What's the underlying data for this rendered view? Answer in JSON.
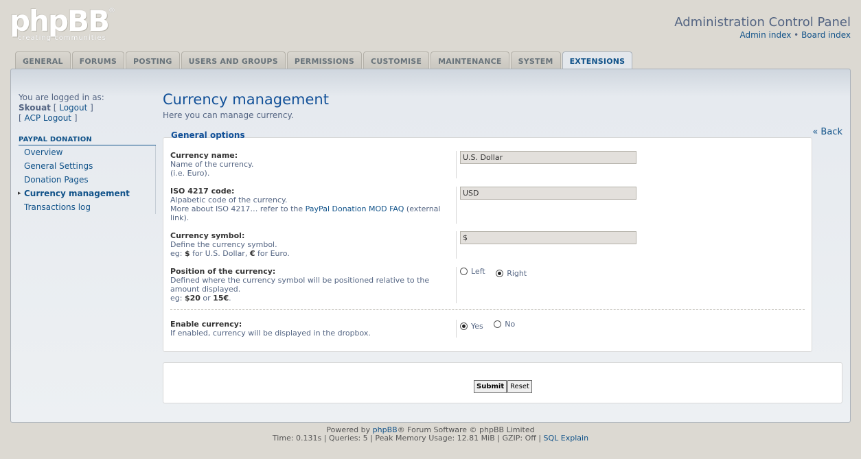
{
  "header": {
    "logo_text": "phpBB",
    "logo_sub": "creating communities",
    "logo_reg": "®",
    "title": "Administration Control Panel",
    "link_admin": "Admin index",
    "link_sep": " • ",
    "link_board": "Board index"
  },
  "tabs": [
    {
      "label": "GENERAL"
    },
    {
      "label": "FORUMS"
    },
    {
      "label": "POSTING"
    },
    {
      "label": "USERS AND GROUPS"
    },
    {
      "label": "PERMISSIONS"
    },
    {
      "label": "CUSTOMISE"
    },
    {
      "label": "MAINTENANCE"
    },
    {
      "label": "SYSTEM"
    },
    {
      "label": "EXTENSIONS"
    }
  ],
  "sidebar": {
    "logged_in_as": "You are logged in as:",
    "username": "Skouat",
    "logout_open": " [ ",
    "logout": "Logout",
    "logout_close": " ]",
    "acp_open": "[ ",
    "acp_logout": "ACP Logout",
    "acp_close": " ]",
    "menu_head": "PAYPAL DONATION",
    "items": [
      {
        "label": "Overview"
      },
      {
        "label": "General Settings"
      },
      {
        "label": "Donation Pages"
      },
      {
        "label": "Currency management"
      },
      {
        "label": "Transactions log"
      }
    ]
  },
  "main": {
    "title": "Currency management",
    "description": "Here you can manage currency.",
    "back": "« Back",
    "legend": "General options",
    "fields": {
      "name": {
        "label": "Currency name:",
        "desc1": "Name of the currency.",
        "desc2": "(i.e. Euro).",
        "value": "U.S. Dollar"
      },
      "iso": {
        "label": "ISO 4217 code:",
        "desc1": "Alpabetic code of the currency.",
        "desc2_pre": "More about ISO 4217… refer to the ",
        "desc2_link": "PayPal Donation MOD FAQ",
        "desc2_post": " (external link).",
        "value": "USD"
      },
      "symbol": {
        "label": "Currency symbol:",
        "desc1": "Define the currency symbol.",
        "desc2_pre": "eg: ",
        "desc2_b1": "$",
        "desc2_mid": " for U.S. Dollar, ",
        "desc2_b2": "€",
        "desc2_post": " for Euro.",
        "value": "$"
      },
      "position": {
        "label": "Position of the currency:",
        "desc1": "Defined where the currency symbol will be positioned relative to the amount displayed.",
        "desc2_pre": "eg: ",
        "desc2_b1": "$20",
        "desc2_mid": " or ",
        "desc2_b2": "15€",
        "desc2_post": ".",
        "option_left": "Left",
        "option_right": "Right",
        "selected": "Right"
      },
      "enable": {
        "label": "Enable currency:",
        "desc1": "If enabled, currency will be displayed in the dropbox.",
        "option_yes": "Yes",
        "option_no": "No",
        "selected": "Yes"
      }
    },
    "submit": "Submit",
    "reset": "Reset"
  },
  "footer": {
    "powered_pre": "Powered by ",
    "powered_link": "phpBB",
    "powered_post": "® Forum Software © phpBB Limited",
    "stats": "Time: 0.131s | Queries: 5 | Peak Memory Usage: 12.81 MiB | GZIP: Off | ",
    "sql_explain": "SQL Explain"
  }
}
